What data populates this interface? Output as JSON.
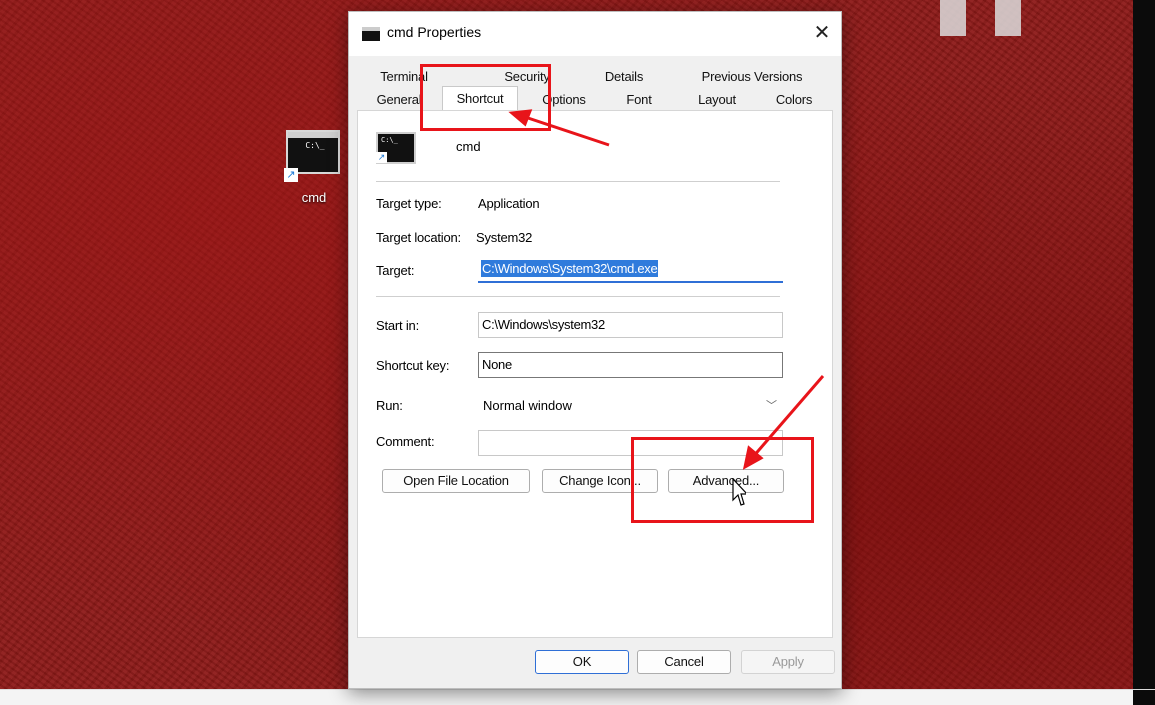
{
  "desktop": {
    "icon_label": "cmd",
    "icon_prompt": "C:\\_"
  },
  "dialog": {
    "title": "cmd Properties",
    "close_glyph": "✕",
    "tabs_row1": [
      "Terminal",
      "Security",
      "Details",
      "Previous Versions"
    ],
    "tabs_row2": [
      "General",
      "Shortcut",
      "Options",
      "Font",
      "Layout",
      "Colors"
    ],
    "active_tab": "Shortcut",
    "app_name": "cmd",
    "fields": {
      "target_type_label": "Target type:",
      "target_type_value": "Application",
      "target_location_label": "Target location:",
      "target_location_value": "System32",
      "target_label": "Target:",
      "target_value": "C:\\Windows\\System32\\cmd.exe",
      "start_in_label": "Start in:",
      "start_in_value": "C:\\Windows\\system32",
      "shortcut_key_label": "Shortcut key:",
      "shortcut_key_value": "None",
      "run_label": "Run:",
      "run_value": "Normal window",
      "comment_label": "Comment:",
      "comment_value": ""
    },
    "buttons": {
      "open_file_location": "Open File Location",
      "change_icon": "Change Icon...",
      "advanced": "Advanced...",
      "ok": "OK",
      "cancel": "Cancel",
      "apply": "Apply"
    }
  },
  "annotation_color": "#e8141a",
  "icons": [
    "cmd-icon",
    "shortcut-arrow-icon",
    "close-icon",
    "chevron-down-icon",
    "mouse-cursor-icon",
    "red-arrow-icon"
  ]
}
